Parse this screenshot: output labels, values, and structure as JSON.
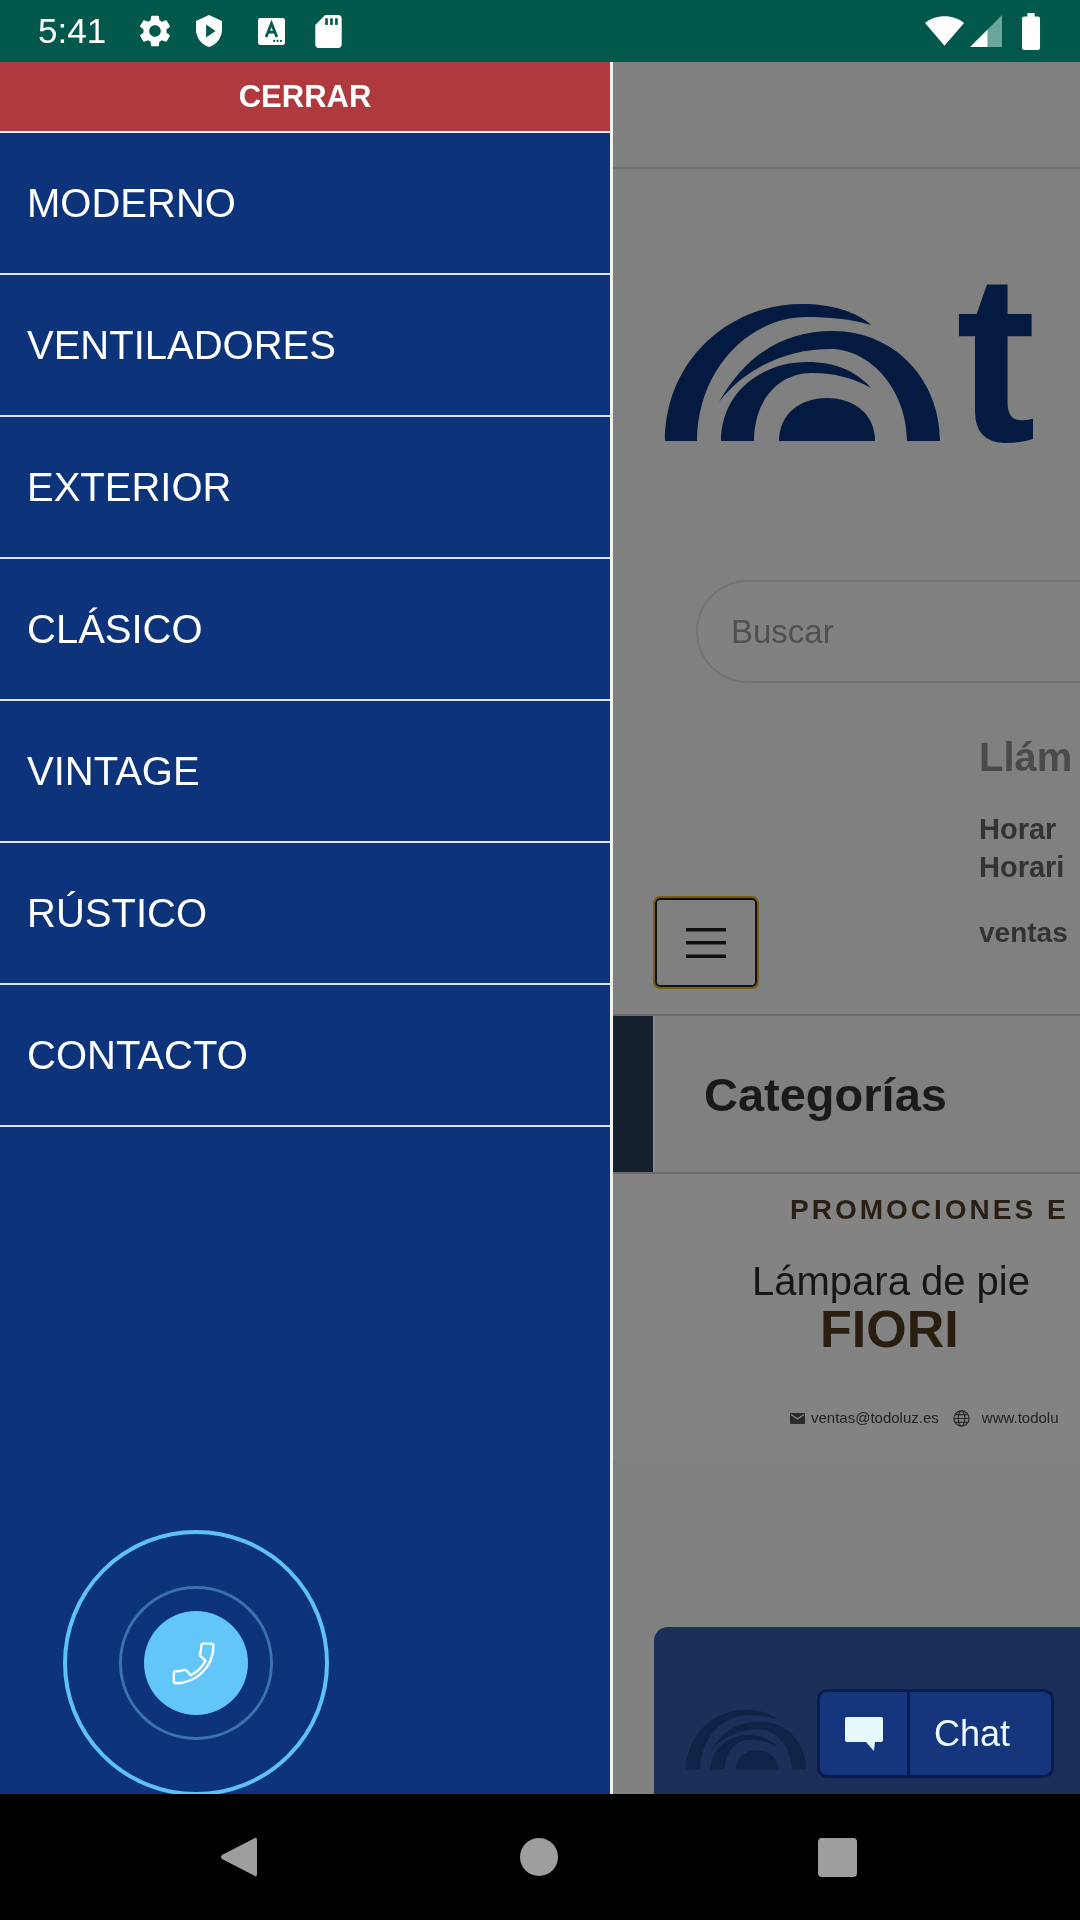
{
  "status_bar": {
    "time": "5:41"
  },
  "drawer": {
    "close_button": {
      "label": "CERRAR"
    },
    "items": [
      {
        "label": "MODERNO"
      },
      {
        "label": "VENTILADORES"
      },
      {
        "label": "EXTERIOR"
      },
      {
        "label": "CLÁSICO"
      },
      {
        "label": "VINTAGE"
      },
      {
        "label": "RÚSTICO"
      },
      {
        "label": "CONTACTO"
      }
    ]
  },
  "page": {
    "logo": {
      "text": "t"
    },
    "search": {
      "placeholder": "Buscar"
    },
    "contact": {
      "heading": "Llám",
      "lines": [
        "Horar",
        "Horari"
      ],
      "email": "ventas"
    },
    "section_title": "Categorías",
    "promo_banner": {
      "headline": "PROMOCIONES E",
      "product_line": "Lámpara de pie",
      "product_name": "FIORI",
      "email": "ventas@todoluz.es",
      "website": "www.todolu"
    }
  },
  "chat_button": {
    "label": "Chat"
  }
}
